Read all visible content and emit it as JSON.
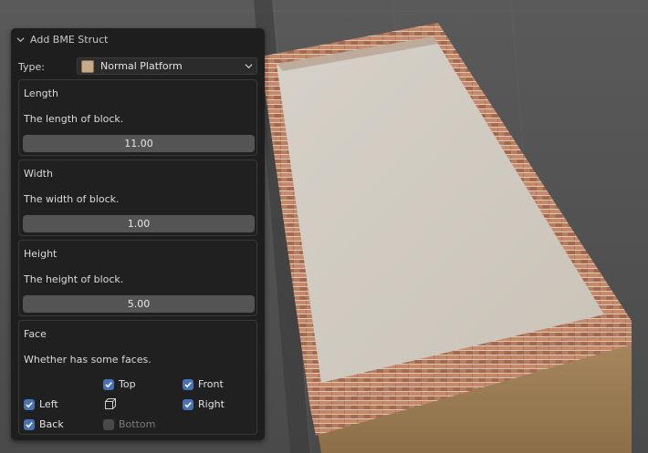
{
  "panel": {
    "header_title": "Add BME Struct",
    "type_label": "Type:",
    "type_value": "Normal Platform"
  },
  "length": {
    "title": "Length",
    "description": "The length of block.",
    "value": "11.00"
  },
  "width": {
    "title": "Width",
    "description": "The width of block.",
    "value": "1.00"
  },
  "height": {
    "title": "Height",
    "description": "The height of block.",
    "value": "5.00"
  },
  "face": {
    "title": "Face",
    "description": "Whether has some faces.",
    "top": {
      "label": "Top",
      "checked": true
    },
    "front": {
      "label": "Front",
      "checked": true
    },
    "left": {
      "label": "Left",
      "checked": true
    },
    "right": {
      "label": "Right",
      "checked": true
    },
    "back": {
      "label": "Back",
      "checked": true
    },
    "bottom": {
      "label": "Bottom",
      "checked": false
    }
  },
  "colors": {
    "checkbox_on": "#4772b3",
    "panel_bg": "#1e1e1e",
    "field_bg": "#545454"
  }
}
